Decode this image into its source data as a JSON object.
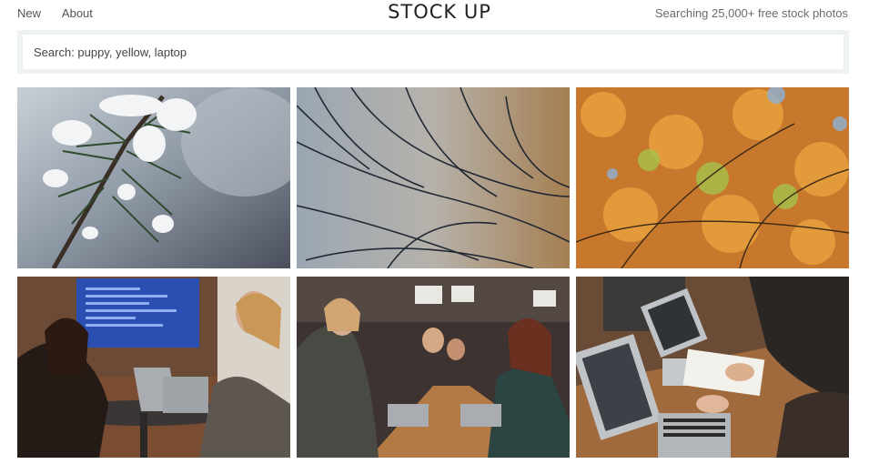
{
  "header": {
    "nav": [
      {
        "label": "New"
      },
      {
        "label": "About"
      }
    ],
    "logo_text": "STOCK UP",
    "tagline": "Searching 25,000+ free stock photos"
  },
  "search": {
    "placeholder": "Search: puppy, yellow, laptop",
    "value": ""
  },
  "photos": [
    {
      "subject": "snowy pine branch"
    },
    {
      "subject": "bare dark branches"
    },
    {
      "subject": "autumn orange leaves"
    },
    {
      "subject": "two women talking at table with laptops"
    },
    {
      "subject": "women working on laptops at long table"
    },
    {
      "subject": "hands typing on laptops"
    }
  ],
  "colors": {
    "search_bg": "#eef2f1",
    "logo": "#222222"
  }
}
